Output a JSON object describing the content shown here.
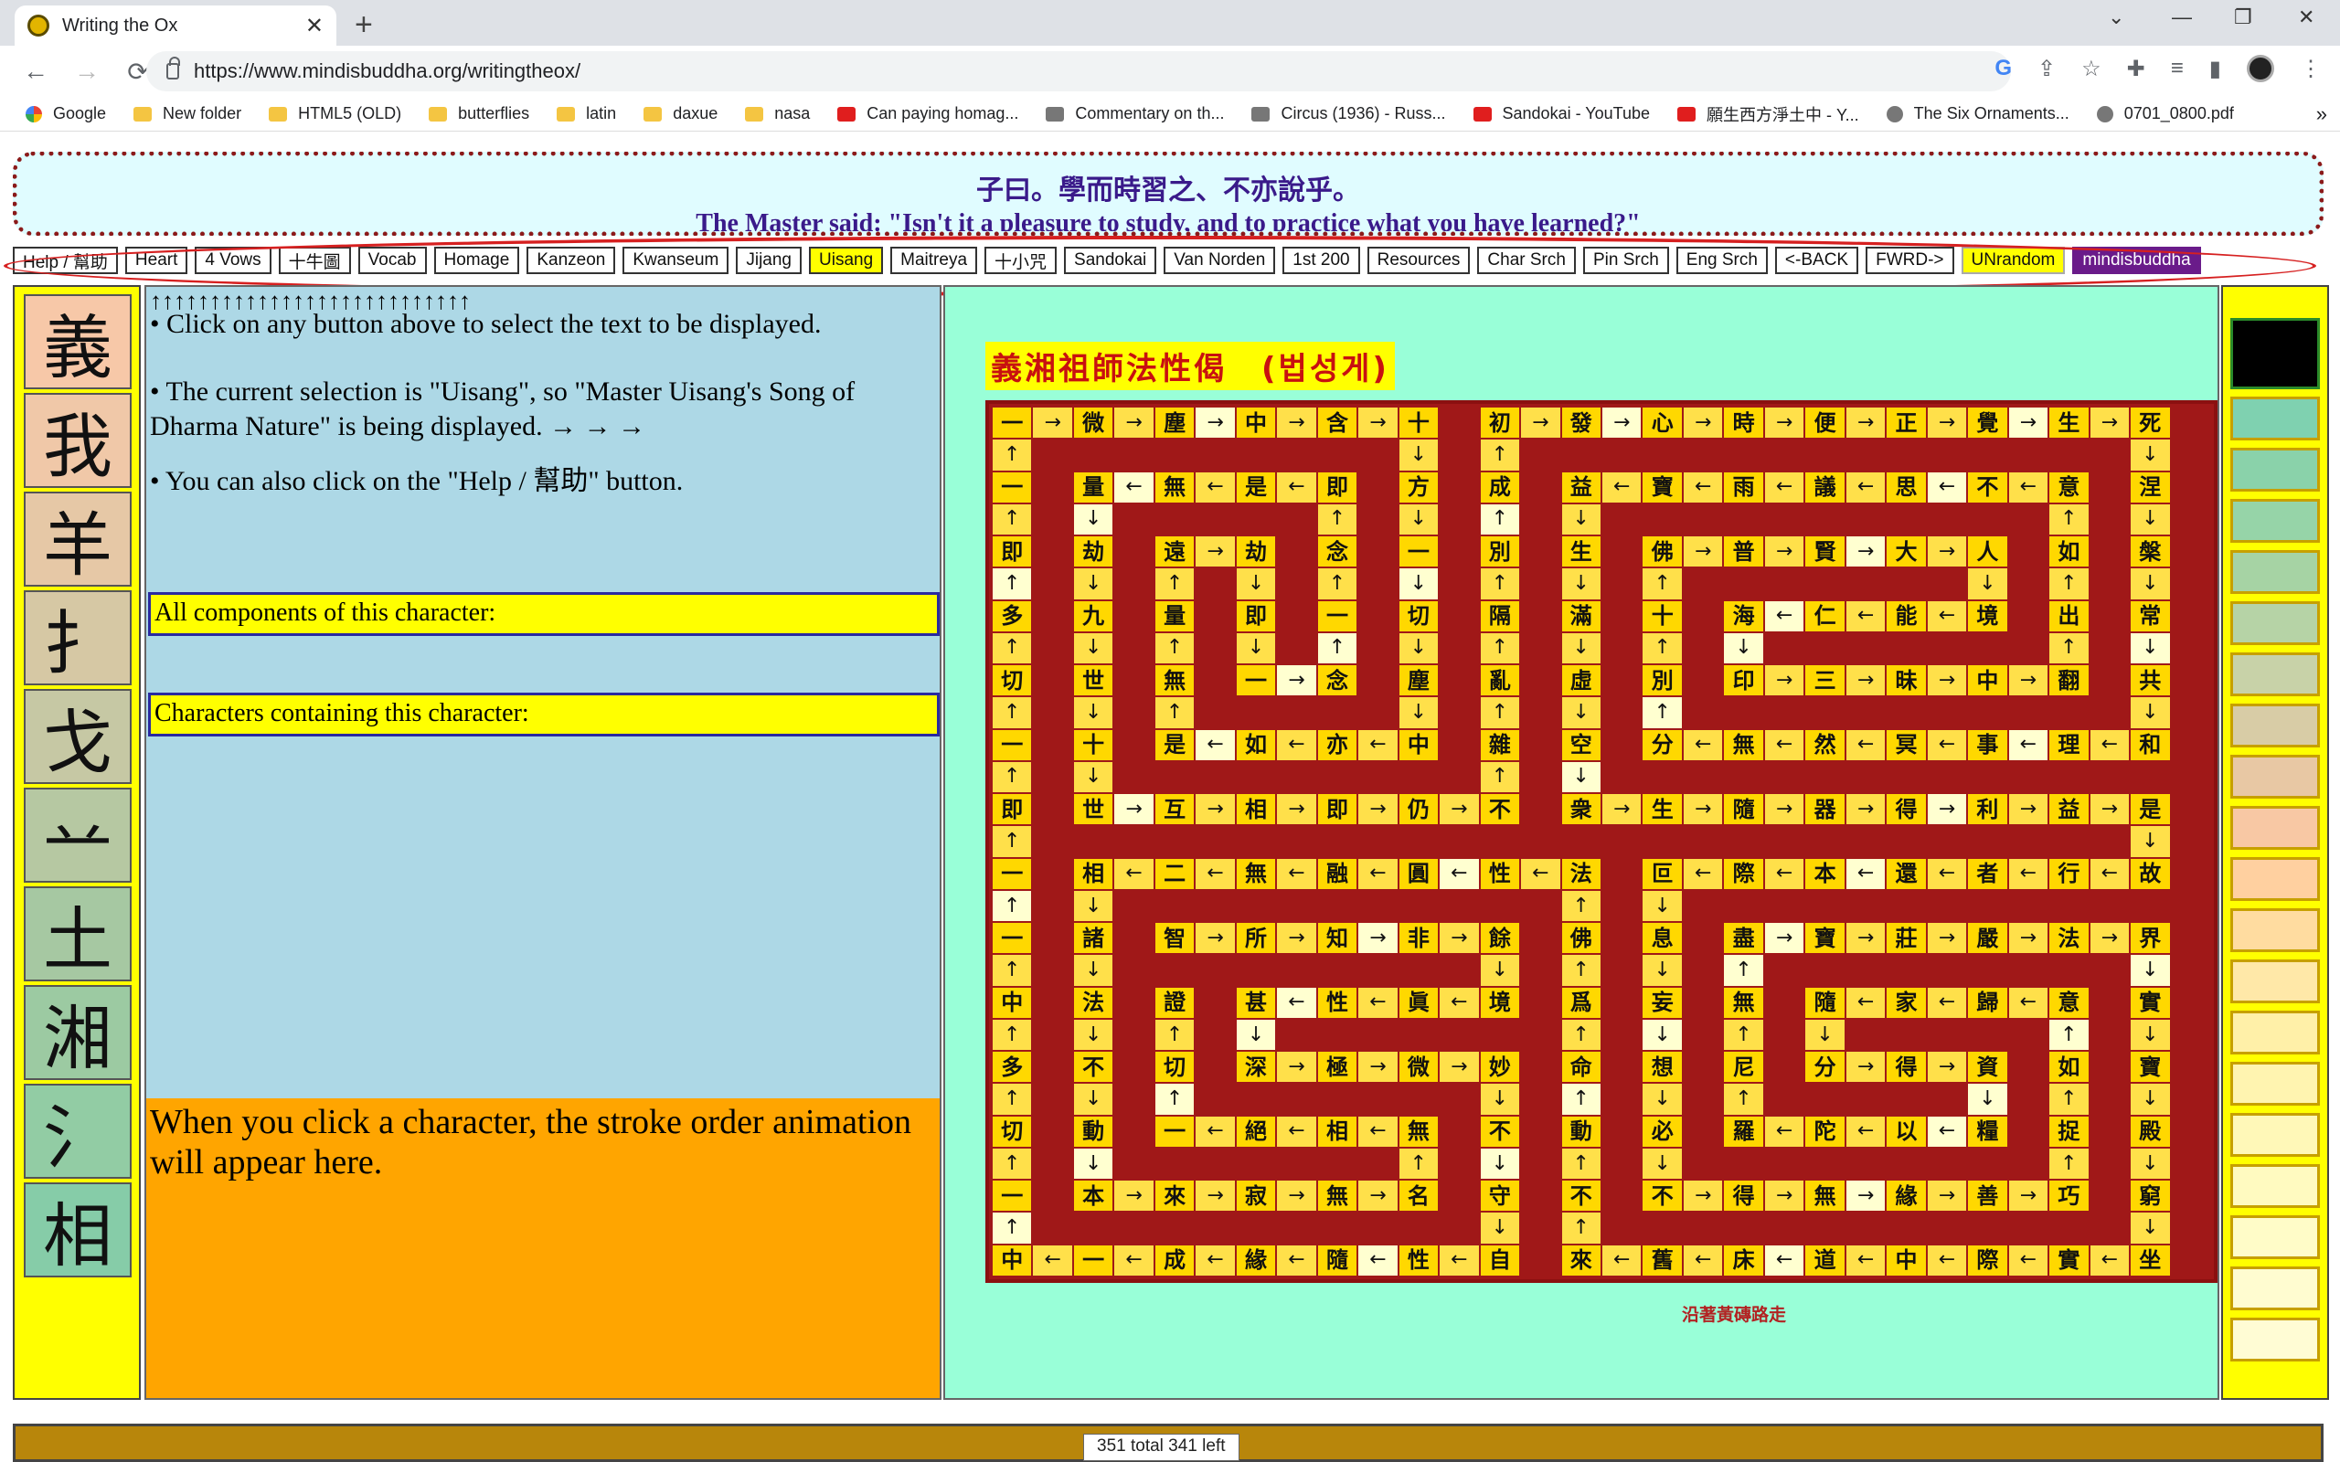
{
  "browser": {
    "tab_title": "Writing the Ox",
    "url": "https://www.mindisbuddha.org/writingtheox/",
    "bookmarks": [
      "Google",
      "New folder",
      "HTML5 (OLD)",
      "butterflies",
      "latin",
      "daxue",
      "nasa",
      "Can paying homag...",
      "Commentary on th...",
      "Circus (1936) - Russ...",
      "Sandokai - YouTube",
      "願生西方淨土中 - Y...",
      "The Six Ornaments...",
      "0701_0800.pdf"
    ]
  },
  "quote": {
    "chinese": "子曰。學而時習之、不亦說乎。",
    "english": "The Master said: \"Isn't it a pleasure to study, and to practice what you have learned?\""
  },
  "nav": [
    "Help / 幫助",
    "Heart",
    "4 Vows",
    "十牛圖",
    "Vocab",
    "Homage",
    "Kanzeon",
    "Kwanseum",
    "Jijang",
    "Uisang",
    "Maitreya",
    "十小咒",
    "Sandokai",
    "Van Norden",
    "1st 200",
    "Resources",
    "Char Srch",
    "Pin Srch",
    "Eng Srch",
    "<-BACK",
    "FWRD->",
    "UNrandom",
    "mindisbuddha"
  ],
  "selected_nav": "Uisang",
  "components": [
    "義",
    "我",
    "羊",
    "扌",
    "戈",
    "䒑",
    "土",
    "湘",
    "氵",
    "相"
  ],
  "info": {
    "arrows": "↑↑↑↑↑↑↑↑↑↑↑↑↑↑↑↑↑↑↑↑↑↑↑↑↑↑↑",
    "line1": "• Click on any button above to select the text to be displayed.",
    "line2": "• The current selection is \"Uisang\", so \"Master Uisang's Song of Dharma Nature\" is being displayed. → → →",
    "line3": "• You can also click on the \"Help / 幫助\" button.",
    "components_label": "All components of this character:",
    "containing_label": "Characters containing this character:",
    "stroke_msg": "When you click a character, the stroke order animation will appear here."
  },
  "poem": {
    "title": "義湘祖師法性偈　(법성게)",
    "bottom_link": "沿著黃磚路走",
    "grid": [
      [
        "一",
        "→",
        "微",
        "→",
        "塵",
        "→",
        "中",
        "→",
        "含",
        "→",
        "十",
        "",
        "初",
        "→",
        "發",
        "→",
        "心",
        "→",
        "時",
        "→",
        "便",
        "→",
        "正",
        "→",
        "覺",
        "→",
        "生",
        "→",
        "死",
        ""
      ],
      [
        "↑",
        "",
        "",
        "",
        "",
        "",
        "",
        "",
        "",
        "",
        "↓",
        "",
        "↑",
        "",
        "",
        "",
        "",
        "",
        "",
        "",
        "",
        "",
        "",
        "",
        "",
        "",
        "",
        "",
        "↓",
        ""
      ],
      [
        "一",
        "",
        "量",
        "←",
        "無",
        "←",
        "是",
        "←",
        "即",
        "",
        "方",
        "",
        "成",
        "",
        "益",
        "←",
        "寶",
        "←",
        "雨",
        "←",
        "議",
        "←",
        "思",
        "←",
        "不",
        "←",
        "意",
        "",
        "涅",
        ""
      ],
      [
        "↑",
        "",
        "↓",
        "",
        "",
        "",
        "",
        "",
        "↑",
        "",
        "↓",
        "",
        "↑",
        "",
        "↓",
        "",
        "",
        "",
        "",
        "",
        "",
        "",
        "",
        "",
        "",
        "",
        "↑",
        "",
        "↓",
        ""
      ],
      [
        "即",
        "",
        "劫",
        "",
        "遠",
        "→",
        "劫",
        "",
        "念",
        "",
        "一",
        "",
        "別",
        "",
        "生",
        "",
        "佛",
        "→",
        "普",
        "→",
        "賢",
        "→",
        "大",
        "→",
        "人",
        "",
        "如",
        "",
        "槃",
        ""
      ],
      [
        "↑",
        "",
        "↓",
        "",
        "↑",
        "",
        "↓",
        "",
        "↑",
        "",
        "↓",
        "",
        "↑",
        "",
        "↓",
        "",
        "↑",
        "",
        "",
        "",
        "",
        "",
        "",
        "",
        "↓",
        "",
        "↑",
        "",
        "↓",
        ""
      ],
      [
        "多",
        "",
        "九",
        "",
        "量",
        "",
        "即",
        "",
        "一",
        "",
        "切",
        "",
        "隔",
        "",
        "滿",
        "",
        "十",
        "",
        "海",
        "←",
        "仁",
        "←",
        "能",
        "←",
        "境",
        "",
        "出",
        "",
        "常",
        ""
      ],
      [
        "↑",
        "",
        "↓",
        "",
        "↑",
        "",
        "↓",
        "",
        "↑",
        "",
        "↓",
        "",
        "↑",
        "",
        "↓",
        "",
        "↑",
        "",
        "↓",
        "",
        "",
        "",
        "",
        "",
        "",
        "",
        "↑",
        "",
        "↓",
        ""
      ],
      [
        "切",
        "",
        "世",
        "",
        "無",
        "",
        "一",
        "→",
        "念",
        "",
        "塵",
        "",
        "亂",
        "",
        "虛",
        "",
        "別",
        "",
        "印",
        "→",
        "三",
        "→",
        "昧",
        "→",
        "中",
        "→",
        "翻",
        "",
        "共",
        ""
      ],
      [
        "↑",
        "",
        "↓",
        "",
        "↑",
        "",
        "",
        "",
        "",
        "",
        "↓",
        "",
        "↑",
        "",
        "↓",
        "",
        "↑",
        "",
        "",
        "",
        "",
        "",
        "",
        "",
        "",
        "",
        "",
        "",
        "↓",
        ""
      ],
      [
        "一",
        "",
        "十",
        "",
        "是",
        "←",
        "如",
        "←",
        "亦",
        "←",
        "中",
        "",
        "雜",
        "",
        "空",
        "",
        "分",
        "←",
        "無",
        "←",
        "然",
        "←",
        "冥",
        "←",
        "事",
        "←",
        "理",
        "←",
        "和",
        ""
      ],
      [
        "↑",
        "",
        "↓",
        "",
        "",
        "",
        "",
        "",
        "",
        "",
        "",
        "",
        "↑",
        "",
        "↓",
        "",
        "",
        "",
        "",
        "",
        "",
        "",
        "",
        "",
        "",
        "",
        "",
        "",
        "",
        ""
      ],
      [
        "即",
        "",
        "世",
        "→",
        "互",
        "→",
        "相",
        "→",
        "即",
        "→",
        "仍",
        "→",
        "不",
        "",
        "衆",
        "→",
        "生",
        "→",
        "隨",
        "→",
        "器",
        "→",
        "得",
        "→",
        "利",
        "→",
        "益",
        "→",
        "是",
        ""
      ],
      [
        "↑",
        "",
        "",
        "",
        "",
        "",
        "",
        "",
        "",
        "",
        "",
        "",
        "",
        "",
        "",
        "",
        "",
        "",
        "",
        "",
        "",
        "",
        "",
        "",
        "",
        "",
        "",
        "",
        "↓",
        ""
      ],
      [
        "一",
        "",
        "相",
        "←",
        "二",
        "←",
        "無",
        "←",
        "融",
        "←",
        "圓",
        "←",
        "性",
        "←",
        "法",
        "",
        "叵",
        "←",
        "際",
        "←",
        "本",
        "←",
        "還",
        "←",
        "者",
        "←",
        "行",
        "←",
        "故",
        ""
      ],
      [
        "↑",
        "",
        "↓",
        "",
        "",
        "",
        "",
        "",
        "",
        "",
        "",
        "",
        "",
        "",
        "↑",
        "",
        "↓",
        "",
        "",
        "",
        "",
        "",
        "",
        "",
        "",
        "",
        "",
        "",
        "",
        ""
      ],
      [
        "一",
        "",
        "諸",
        "",
        "智",
        "→",
        "所",
        "→",
        "知",
        "→",
        "非",
        "→",
        "餘",
        "",
        "佛",
        "",
        "息",
        "",
        "盡",
        "→",
        "寶",
        "→",
        "莊",
        "→",
        "嚴",
        "→",
        "法",
        "→",
        "界",
        ""
      ],
      [
        "↑",
        "",
        "↓",
        "",
        "",
        "",
        "",
        "",
        "",
        "",
        "",
        "",
        "↓",
        "",
        "↑",
        "",
        "↓",
        "",
        "↑",
        "",
        "",
        "",
        "",
        "",
        "",
        "",
        "",
        "",
        "↓",
        ""
      ],
      [
        "中",
        "",
        "法",
        "",
        "證",
        "",
        "甚",
        "←",
        "性",
        "←",
        "眞",
        "←",
        "境",
        "",
        "爲",
        "",
        "妄",
        "",
        "無",
        "",
        "隨",
        "←",
        "家",
        "←",
        "歸",
        "←",
        "意",
        "",
        "實",
        ""
      ],
      [
        "↑",
        "",
        "↓",
        "",
        "↑",
        "",
        "↓",
        "",
        "",
        "",
        "",
        "",
        "",
        "",
        "↑",
        "",
        "↓",
        "",
        "↑",
        "",
        "↓",
        "",
        "",
        "",
        "",
        "",
        "↑",
        "",
        "↓",
        ""
      ],
      [
        "多",
        "",
        "不",
        "",
        "切",
        "",
        "深",
        "→",
        "極",
        "→",
        "微",
        "→",
        "妙",
        "",
        "命",
        "",
        "想",
        "",
        "尼",
        "",
        "分",
        "→",
        "得",
        "→",
        "資",
        "",
        "如",
        "",
        "寶",
        ""
      ],
      [
        "↑",
        "",
        "↓",
        "",
        "↑",
        "",
        "",
        "",
        "",
        "",
        "",
        "",
        "↓",
        "",
        "↑",
        "",
        "↓",
        "",
        "↑",
        "",
        "",
        "",
        "",
        "",
        "↓",
        "",
        "↑",
        "",
        "↓",
        ""
      ],
      [
        "切",
        "",
        "動",
        "",
        "一",
        "←",
        "絕",
        "←",
        "相",
        "←",
        "無",
        "",
        "不",
        "",
        "動",
        "",
        "必",
        "",
        "羅",
        "←",
        "陀",
        "←",
        "以",
        "←",
        "糧",
        "",
        "捉",
        "",
        "殿",
        ""
      ],
      [
        "↑",
        "",
        "↓",
        "",
        "",
        "",
        "",
        "",
        "",
        "",
        "↑",
        "",
        "↓",
        "",
        "↑",
        "",
        "↓",
        "",
        "",
        "",
        "",
        "",
        "",
        "",
        "",
        "",
        "↑",
        "",
        "↓",
        ""
      ],
      [
        "一",
        "",
        "本",
        "→",
        "來",
        "→",
        "寂",
        "→",
        "無",
        "→",
        "名",
        "",
        "守",
        "",
        "不",
        "",
        "不",
        "→",
        "得",
        "→",
        "無",
        "→",
        "緣",
        "→",
        "善",
        "→",
        "巧",
        "",
        "窮",
        ""
      ],
      [
        "↑",
        "",
        "",
        "",
        "",
        "",
        "",
        "",
        "",
        "",
        "",
        "",
        "↓",
        "",
        "↑",
        "",
        "",
        "",
        "",
        "",
        "",
        "",
        "",
        "",
        "",
        "",
        "",
        "",
        "↓",
        ""
      ],
      [
        "中",
        "←",
        "一",
        "←",
        "成",
        "←",
        "緣",
        "←",
        "隨",
        "←",
        "性",
        "←",
        "自",
        "",
        "來",
        "←",
        "舊",
        "←",
        "床",
        "←",
        "道",
        "←",
        "中",
        "←",
        "際",
        "←",
        "實",
        "←",
        "坐",
        ""
      ]
    ]
  },
  "swatches": [
    "#000000",
    "#7fd1b0",
    "#8ad2aa",
    "#96d4a8",
    "#a6d3a4",
    "#b6d3a6",
    "#c8d2a8",
    "#d8cca6",
    "#e8c8a4",
    "#f8c8a4",
    "#ffd0a0",
    "#ffdca0",
    "#ffe8a8",
    "#fff0a8",
    "#fff4b0",
    "#fff8b8",
    "#fffac0",
    "#fffcc8",
    "#fffcd0",
    "#fffcd4"
  ],
  "swatch_outline": "#2a8a2a",
  "component_colors": [
    "#f7c8a8",
    "#f0c8a8",
    "#e6c8a6",
    "#d6c8a4",
    "#c6c8a4",
    "#b6c8a2",
    "#a6c8a2",
    "#9ccaa2",
    "#92cca4",
    "#86cca8"
  ],
  "status": "351 total 341 left"
}
